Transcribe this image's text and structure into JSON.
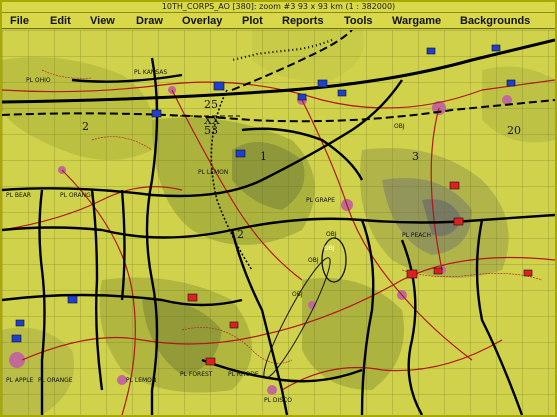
{
  "window": {
    "title": "10TH_CORPS_AO [380]:  zoom #3   93 x 93 km (1 : 382000)"
  },
  "menu": {
    "items": [
      {
        "id": "file",
        "label": "File"
      },
      {
        "id": "edit",
        "label": "Edit"
      },
      {
        "id": "view",
        "label": "View"
      },
      {
        "id": "draw",
        "label": "Draw"
      },
      {
        "id": "overlay",
        "label": "Overlay"
      },
      {
        "id": "plot",
        "label": "Plot"
      },
      {
        "id": "reports",
        "label": "Reports"
      },
      {
        "id": "tools",
        "label": "Tools"
      },
      {
        "id": "wargame",
        "label": "Wargame"
      },
      {
        "id": "backgrounds",
        "label": "Backgrounds"
      }
    ]
  },
  "map": {
    "division_symbol": {
      "top": "25",
      "middle": "XX",
      "bottom": "53"
    },
    "phase_lines": {
      "pl_ohio": "PL OHIO",
      "pl_kansas": "PL KANSAS",
      "pl_bear": "PL BEAR",
      "pl_orange": "PL ORANGE",
      "pl_lemon": "PL LEMON",
      "pl_lemon_2": "PL LEMON",
      "pl_grape": "PL GRAPE",
      "pl_peach": "PL PEACH",
      "pl_orange_2": "PL ORANGE",
      "pl_forest": "PL FOREST",
      "pl_rhode": "PL RHODE",
      "pl_apple": "PL APPLE",
      "pl_disco": "PL DISCO"
    },
    "objectives": {
      "obj_1": "OBJ",
      "obj_2": "OBJ",
      "obj_3": "OBJ",
      "obj_4": "OBJ",
      "obj_5": "OBJ"
    },
    "unit_numbers": {
      "u2": "2",
      "u1": "1",
      "u3": "3",
      "u20": "20",
      "u2b": "2"
    },
    "colors": {
      "frame": "#a8a800",
      "menu_bg": "#d8d84a",
      "terrain_base": "#cfd24a",
      "terrain_hill": "#9aa23a",
      "friendly_unit": "#1f3fd0",
      "enemy_unit": "#e02020",
      "boundary": "#000000",
      "road": "#b01818",
      "urban": "#c06a9a"
    }
  }
}
